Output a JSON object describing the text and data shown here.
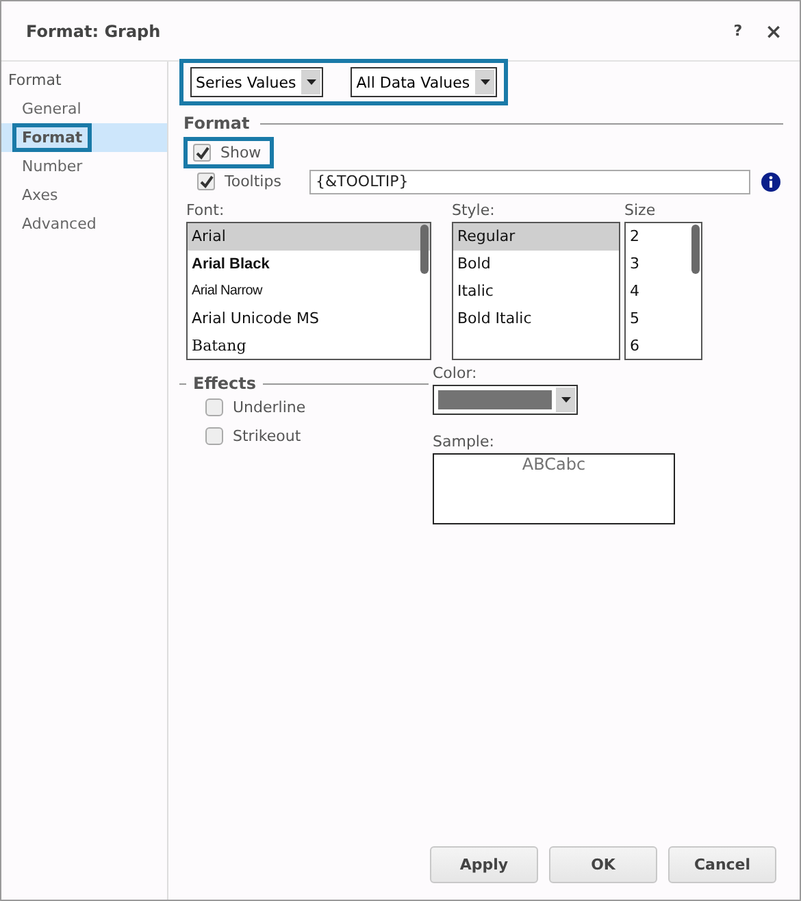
{
  "window": {
    "title": "Format: Graph",
    "help": "?",
    "close": "×"
  },
  "sidebar": {
    "heading": "Format",
    "items": [
      {
        "label": "General",
        "selected": false,
        "highlighted": false
      },
      {
        "label": "Format",
        "selected": true,
        "highlighted": true
      },
      {
        "label": "Number",
        "selected": false,
        "highlighted": false
      },
      {
        "label": "Axes",
        "selected": false,
        "highlighted": false
      },
      {
        "label": "Advanced",
        "selected": false,
        "highlighted": false
      }
    ]
  },
  "selectors": {
    "highlighted": true,
    "dropdowns": [
      {
        "value": "Series Values"
      },
      {
        "value": "All Data Values"
      }
    ]
  },
  "format": {
    "heading": "Format",
    "show": {
      "label": "Show",
      "checked": true,
      "highlighted": true
    },
    "tooltips": {
      "label": "Tooltips",
      "checked": true,
      "value": "{&TOOLTIP}"
    },
    "font": {
      "label": "Font:",
      "items": [
        {
          "label": "Arial",
          "kind": "plain",
          "selected": true
        },
        {
          "label": "Arial Black",
          "kind": "black",
          "selected": false
        },
        {
          "label": "Arial Narrow",
          "kind": "narrow",
          "selected": false
        },
        {
          "label": "Arial Unicode MS",
          "kind": "plain",
          "selected": false
        },
        {
          "label": "Batang",
          "kind": "serif",
          "selected": false
        }
      ]
    },
    "style": {
      "label": "Style:",
      "items": [
        {
          "label": "Regular",
          "selected": true
        },
        {
          "label": "Bold",
          "selected": false
        },
        {
          "label": "Italic",
          "selected": false
        },
        {
          "label": "Bold Italic",
          "selected": false
        }
      ]
    },
    "size": {
      "label": "Size",
      "items": [
        {
          "label": "2",
          "selected": false
        },
        {
          "label": "3",
          "selected": false
        },
        {
          "label": "4",
          "selected": false
        },
        {
          "label": "5",
          "selected": false
        },
        {
          "label": "6",
          "selected": false
        }
      ]
    },
    "effects": {
      "heading": "Effects",
      "options": [
        {
          "label": "Underline",
          "checked": false
        },
        {
          "label": "Strikeout",
          "checked": false
        }
      ]
    },
    "color": {
      "label": "Color:",
      "color": "#737373"
    },
    "sample": {
      "label": "Sample:",
      "text": "ABCabc"
    }
  },
  "buttons": [
    "Apply",
    "OK",
    "Cancel"
  ]
}
